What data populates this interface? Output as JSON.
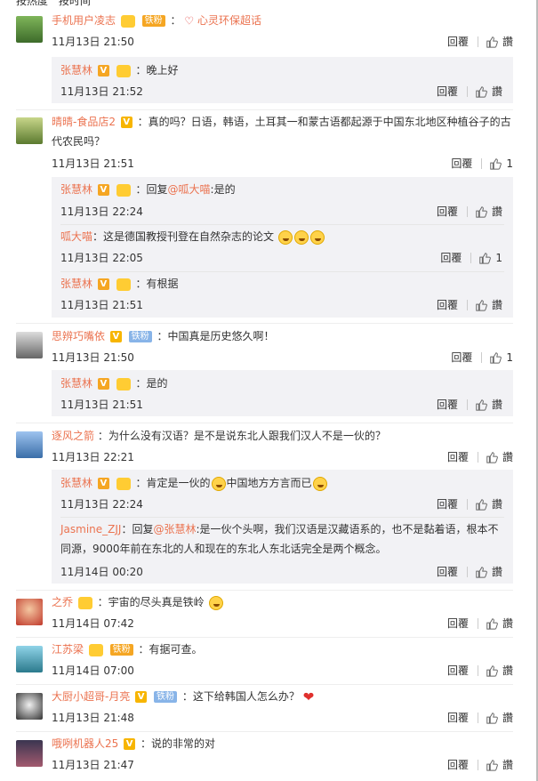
{
  "top": {
    "label_a": "按热度",
    "label_b": "按时间"
  },
  "labels": {
    "reply": "回覆",
    "like": "讚"
  },
  "comments": [
    {
      "user": "手机用户凌志",
      "fan_badge": "铁粉",
      "text": "心灵环保超话",
      "time": "11月13日 21:50",
      "likes": "讚",
      "subs": [
        {
          "user": "张慧林",
          "text": "：晚上好",
          "time": "11月13日 21:52",
          "likes": "讚"
        }
      ]
    },
    {
      "user": "晴晴-食品店2",
      "text": "：真的吗？日语，韩语，土耳其一和蒙古语都起源于中国东北地区种植谷子的古代农民吗？",
      "time": "11月13日 21:51",
      "likes": "1",
      "subs": [
        {
          "user": "张慧林",
          "text_prefix": "：回复",
          "mention": "@呱大喵",
          "text": ":是的",
          "time": "11月13日 22:24",
          "likes": "讚"
        },
        {
          "user": "呱大喵",
          "text": "：这是德国教授刊登在自然杂志的论文",
          "time": "11月13日 22:05",
          "likes": "1"
        },
        {
          "user": "张慧林",
          "text": "：有根据",
          "time": "11月13日 21:51",
          "likes": "讚"
        }
      ]
    },
    {
      "user": "思辨巧嘴依",
      "fan_badge": "铁粉",
      "text": "：中国真是历史悠久啊！",
      "time": "11月13日 21:50",
      "likes": "1",
      "subs": [
        {
          "user": "张慧林",
          "text": "：是的",
          "time": "11月13日 21:51",
          "likes": "讚"
        }
      ]
    },
    {
      "user": "逐风之箭",
      "text": "：为什么没有汉语？是不是说东北人跟我们汉人不是一伙的？",
      "time": "11月13日 22:21",
      "likes": "讚",
      "subs": [
        {
          "user": "张慧林",
          "text_a": "：肯定是一伙的",
          "text_b": "中国地方方言而已",
          "time": "11月13日 22:24",
          "likes": "讚"
        },
        {
          "user": "Jasmine_ZJJ",
          "text_prefix": "：回复",
          "mention": "@张慧林",
          "text": ":是一伙个头啊，我们汉语是汉藏语系的，也不是黏着语，根本不同源，9000年前在东北的人和现在的东北人东北话完全是两个概念。",
          "time": "11月14日 00:20",
          "likes": "讚"
        }
      ]
    },
    {
      "user": "之乔",
      "text": "：宇宙的尽头真是铁岭",
      "time": "11月14日 07:42",
      "likes": "讚"
    },
    {
      "user": "江苏梁",
      "fan_badge": "铁粉",
      "text": "：有据可查。",
      "time": "11月14日 07:00",
      "likes": "讚"
    },
    {
      "user": "大厨小超哥-月亮",
      "fan_badge": "铁粉",
      "text": "：这下给韩国人怎么办？",
      "time": "11月13日 21:48",
      "likes": "讚"
    },
    {
      "user": "哦咧机器人25",
      "text": "：说的非常的对",
      "time": "11月13日 21:47",
      "likes": "讚"
    }
  ]
}
